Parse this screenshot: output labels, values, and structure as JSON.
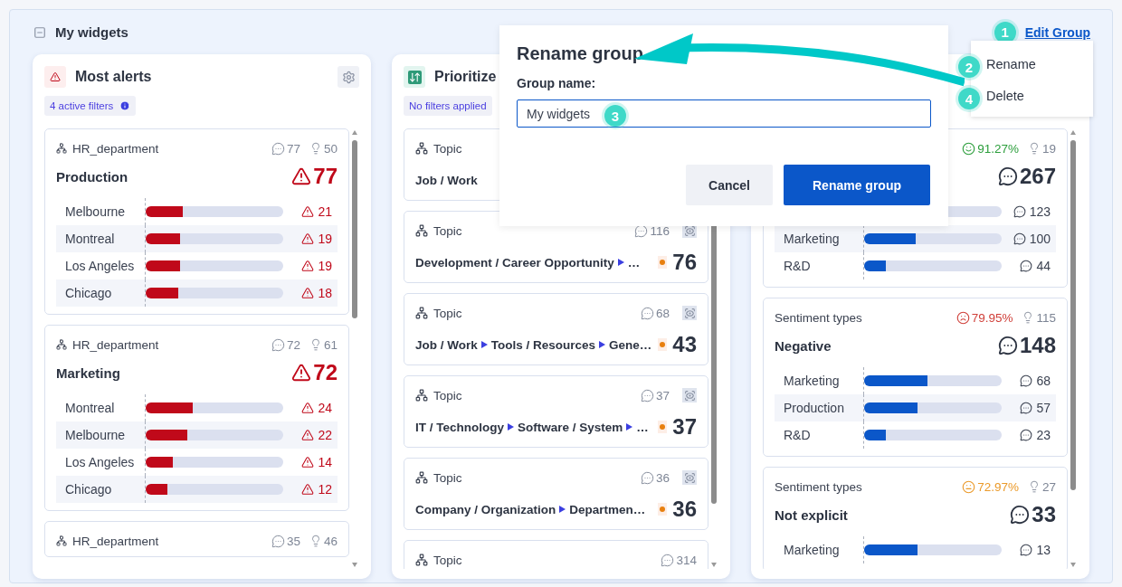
{
  "group": {
    "title": "My widgets"
  },
  "edit_link": {
    "label": "Edit Group",
    "step": "1"
  },
  "menu": [
    {
      "label": "Rename",
      "step": "2"
    },
    {
      "label": "Delete",
      "step": "4"
    }
  ],
  "widgets": [
    {
      "kind": "alerts",
      "title": "Most alerts",
      "filter": "4 active filters",
      "filter_info": true,
      "items": [
        {
          "kind": "alert_breakdown",
          "label": "HR_department",
          "stats": [
            {
              "kind": "comments",
              "value": "77"
            },
            {
              "kind": "ideas",
              "value": "50"
            }
          ],
          "name": "Production",
          "total": "77",
          "rows": [
            {
              "name": "Melbourne",
              "level": 0.27,
              "value": "21"
            },
            {
              "name": "Montreal",
              "level": 0.25,
              "value": "19"
            },
            {
              "name": "Los Angeles",
              "level": 0.25,
              "value": "19"
            },
            {
              "name": "Chicago",
              "level": 0.24,
              "value": "18"
            }
          ]
        },
        {
          "kind": "alert_breakdown",
          "label": "HR_department",
          "stats": [
            {
              "kind": "comments",
              "value": "72"
            },
            {
              "kind": "ideas",
              "value": "61"
            }
          ],
          "name": "Marketing",
          "total": "72",
          "rows": [
            {
              "name": "Montreal",
              "level": 0.34,
              "value": "24"
            },
            {
              "name": "Melbourne",
              "level": 0.3,
              "value": "22"
            },
            {
              "name": "Los Angeles",
              "level": 0.2,
              "value": "14"
            },
            {
              "name": "Chicago",
              "level": 0.16,
              "value": "12"
            }
          ]
        },
        {
          "kind": "alert_breakdown",
          "label": "HR_department",
          "stats": [
            {
              "kind": "comments",
              "value": "35"
            },
            {
              "kind": "ideas",
              "value": "46"
            }
          ]
        }
      ]
    },
    {
      "kind": "priority",
      "title": "Prioritize",
      "filter": "No filters applied",
      "items": [
        {
          "kind": "topic",
          "label": "Topic",
          "path": [
            "Job / Work"
          ]
        },
        {
          "kind": "topic",
          "label": "Topic",
          "stats": [
            {
              "kind": "comments",
              "value": "116"
            }
          ],
          "watched": true,
          "path": [
            "Development / Career Opportunity",
            "…"
          ],
          "score": "76"
        },
        {
          "kind": "topic",
          "label": "Topic",
          "stats": [
            {
              "kind": "comments",
              "value": "68"
            }
          ],
          "watched": true,
          "path": [
            "Job / Work",
            "Tools / Resources",
            "Gene…"
          ],
          "score": "43"
        },
        {
          "kind": "topic",
          "label": "Topic",
          "stats": [
            {
              "kind": "comments",
              "value": "37"
            }
          ],
          "watched": true,
          "path": [
            "IT / Technology",
            "Software / System",
            "…"
          ],
          "score": "37"
        },
        {
          "kind": "topic",
          "label": "Topic",
          "stats": [
            {
              "kind": "comments",
              "value": "36"
            }
          ],
          "watched": true,
          "path": [
            "Company / Organization",
            "Departmen…"
          ],
          "score": "36"
        },
        {
          "kind": "topic",
          "label": "Topic",
          "stats": [
            {
              "kind": "comments",
              "value": "314"
            }
          ]
        }
      ]
    },
    {
      "kind": "sentiment",
      "items": [
        {
          "kind": "comment_breakdown",
          "stats": [
            {
              "kind": "positive",
              "value": "91.27%"
            },
            {
              "kind": "ideas",
              "value": "19"
            }
          ],
          "total": "267",
          "rows": [
            {
              "value": "123"
            },
            {
              "name": "Marketing",
              "level": 0.375,
              "value": "100"
            },
            {
              "name": "R&D",
              "level": 0.16,
              "value": "44"
            }
          ]
        },
        {
          "kind": "comment_breakdown",
          "label": "Sentiment types",
          "stats": [
            {
              "kind": "negative",
              "value": "79.95%"
            },
            {
              "kind": "ideas",
              "value": "115"
            }
          ],
          "name": "Negative",
          "total": "148",
          "rows": [
            {
              "name": "Marketing",
              "level": 0.46,
              "value": "68"
            },
            {
              "name": "Production",
              "level": 0.39,
              "value": "57"
            },
            {
              "name": "R&D",
              "level": 0.16,
              "value": "23"
            }
          ]
        },
        {
          "kind": "comment_breakdown",
          "label": "Sentiment types",
          "stats": [
            {
              "kind": "neutral",
              "value": "72.97%"
            },
            {
              "kind": "ideas",
              "value": "27"
            }
          ],
          "name": "Not explicit",
          "total": "33",
          "rows": [
            {
              "name": "Marketing",
              "level": 0.39,
              "value": "13"
            }
          ]
        }
      ]
    }
  ],
  "dialog": {
    "title": "Rename group",
    "field_label": "Group name:",
    "value": "My widgets",
    "step": "3",
    "buttons": [
      {
        "label": "Cancel",
        "kind": "secondary"
      },
      {
        "label": "Rename group",
        "kind": "primary"
      }
    ]
  }
}
